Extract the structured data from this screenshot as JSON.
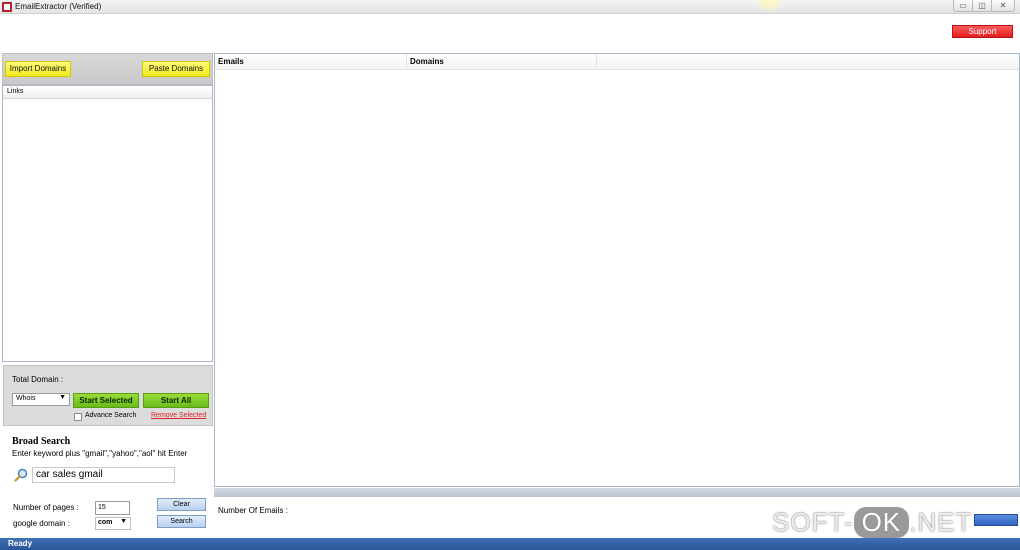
{
  "window": {
    "title": "EmailExtractor  (Verified)",
    "controls": {
      "minimize": "▭",
      "maximize": "◫",
      "close": "✕"
    }
  },
  "support_label": "Support",
  "left_panel": {
    "import_label": "Import Domains",
    "paste_label": "Paste Domains",
    "links_header": "Links"
  },
  "controls": {
    "total_domain_label": "Total Domain :",
    "lookup_selected": "Whois",
    "start_selected_label": "Start Selected",
    "start_all_label": "Start All",
    "advance_search_label": "Advance Search",
    "advance_search_checked": false,
    "remove_selected_label": "Remove Selected"
  },
  "broad_search": {
    "title": "Broad Search",
    "hint": "Enter keyword plus \"gmail\",\"yahoo\",\"aol\" hit Enter",
    "keyword_value": "car sales gmail",
    "pages_label": "Number of pages :",
    "pages_value": "15",
    "google_domain_label": "google domain   :",
    "google_domain_value": "com",
    "clear_label": "Clear",
    "search_label": "Search"
  },
  "results": {
    "columns": [
      "Emails",
      "Domains"
    ],
    "rows": []
  },
  "bottom": {
    "number_of_emails_label": "Number Of Emails :"
  },
  "status": {
    "text": "Ready"
  },
  "watermark": {
    "left": "SOFT-",
    "mid": "OK",
    "right": ".NET"
  },
  "colors": {
    "support": "#e01e1e",
    "yellow_button": "#f2ea1a",
    "green_button": "#6abb1a",
    "status_bar": "#2a5598",
    "remove_link": "#e0202a"
  },
  "icons": {
    "app": "app-icon",
    "keyword_search": "magnifier-icon"
  }
}
